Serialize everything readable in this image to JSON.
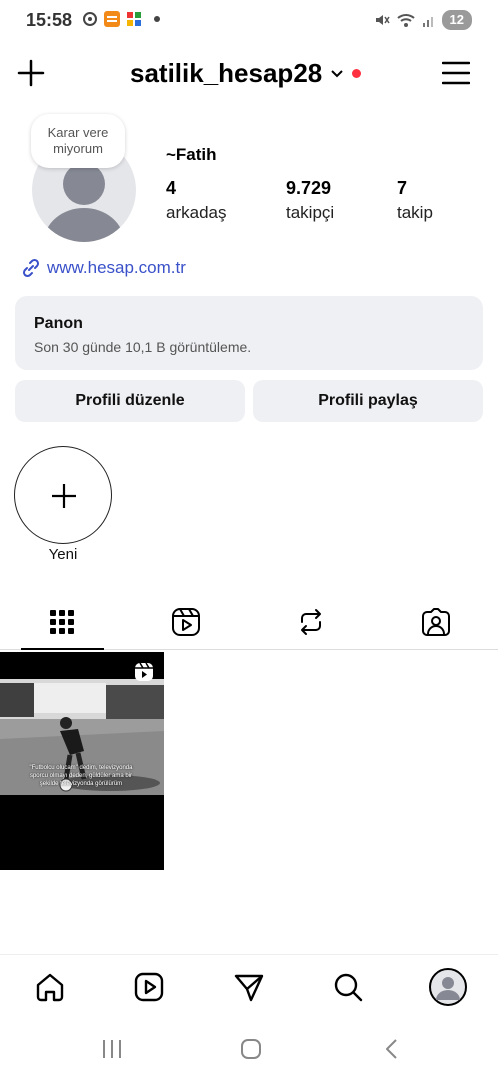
{
  "status_bar": {
    "time": "15:58",
    "battery": "12",
    "left_icons": [
      "sync-icon",
      "app-icon",
      "grid-app-icon",
      "notification-dot-icon"
    ],
    "right_icons": [
      "mute-icon",
      "wifi-icon",
      "signal-icon"
    ]
  },
  "header": {
    "username": "satilik_hesap28",
    "icons": [
      "plus-icon",
      "chevron-down-icon",
      "notification-dot",
      "menu-icon"
    ],
    "accent_red": "#ff3040"
  },
  "profile": {
    "note": "Karar vere miyorum",
    "display_name": "~Fatih",
    "stats": [
      {
        "value": "4",
        "label": "arkadaş"
      },
      {
        "value": "9.729",
        "label": "takipçi"
      },
      {
        "value": "7",
        "label": "takip"
      }
    ],
    "link": "www.hesap.com.tr",
    "link_color": "#3a51c9"
  },
  "dashboard": {
    "title": "Panon",
    "subtitle": "Son 30 günde 10,1 B görüntüleme."
  },
  "actions": {
    "edit_profile": "Profili düzenle",
    "share_profile": "Profili paylaş"
  },
  "highlights": {
    "new_label": "Yeni"
  },
  "tabs": [
    {
      "icon": "grid-icon",
      "active": true
    },
    {
      "icon": "reels-icon",
      "active": false
    },
    {
      "icon": "repost-icon",
      "active": false
    },
    {
      "icon": "tagged-icon",
      "active": false
    }
  ],
  "posts": [
    {
      "type": "reel",
      "caption": "\"Futbolcu olucam\" dedim, televizyonda sporcu olmayı deden, güldüler ama bir şekilde televizyonda görülürüm"
    }
  ],
  "bottom_nav": [
    "home-icon",
    "reels-icon",
    "send-icon",
    "search-icon",
    "profile-avatar"
  ],
  "system_nav": [
    "recents-icon",
    "home-button-icon",
    "back-icon"
  ]
}
